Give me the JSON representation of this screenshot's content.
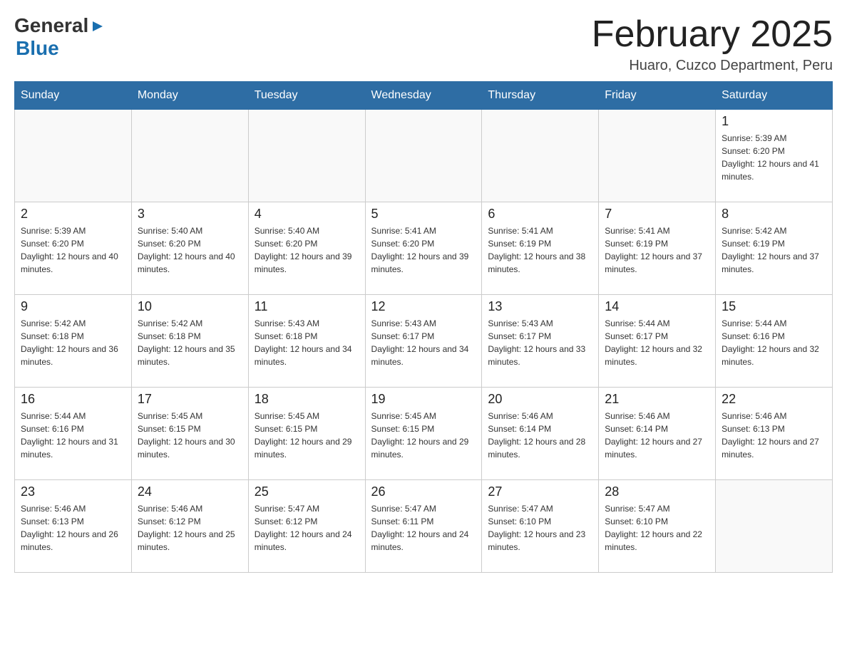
{
  "header": {
    "logo": {
      "general": "General",
      "arrow": "▶",
      "blue": "Blue"
    },
    "title": "February 2025",
    "subtitle": "Huaro, Cuzco Department, Peru"
  },
  "days_of_week": [
    "Sunday",
    "Monday",
    "Tuesday",
    "Wednesday",
    "Thursday",
    "Friday",
    "Saturday"
  ],
  "weeks": [
    [
      {
        "day": "",
        "sunrise": "",
        "sunset": "",
        "daylight": "",
        "empty": true
      },
      {
        "day": "",
        "sunrise": "",
        "sunset": "",
        "daylight": "",
        "empty": true
      },
      {
        "day": "",
        "sunrise": "",
        "sunset": "",
        "daylight": "",
        "empty": true
      },
      {
        "day": "",
        "sunrise": "",
        "sunset": "",
        "daylight": "",
        "empty": true
      },
      {
        "day": "",
        "sunrise": "",
        "sunset": "",
        "daylight": "",
        "empty": true
      },
      {
        "day": "",
        "sunrise": "",
        "sunset": "",
        "daylight": "",
        "empty": true
      },
      {
        "day": "1",
        "sunrise": "Sunrise: 5:39 AM",
        "sunset": "Sunset: 6:20 PM",
        "daylight": "Daylight: 12 hours and 41 minutes.",
        "empty": false
      }
    ],
    [
      {
        "day": "2",
        "sunrise": "Sunrise: 5:39 AM",
        "sunset": "Sunset: 6:20 PM",
        "daylight": "Daylight: 12 hours and 40 minutes.",
        "empty": false
      },
      {
        "day": "3",
        "sunrise": "Sunrise: 5:40 AM",
        "sunset": "Sunset: 6:20 PM",
        "daylight": "Daylight: 12 hours and 40 minutes.",
        "empty": false
      },
      {
        "day": "4",
        "sunrise": "Sunrise: 5:40 AM",
        "sunset": "Sunset: 6:20 PM",
        "daylight": "Daylight: 12 hours and 39 minutes.",
        "empty": false
      },
      {
        "day": "5",
        "sunrise": "Sunrise: 5:41 AM",
        "sunset": "Sunset: 6:20 PM",
        "daylight": "Daylight: 12 hours and 39 minutes.",
        "empty": false
      },
      {
        "day": "6",
        "sunrise": "Sunrise: 5:41 AM",
        "sunset": "Sunset: 6:19 PM",
        "daylight": "Daylight: 12 hours and 38 minutes.",
        "empty": false
      },
      {
        "day": "7",
        "sunrise": "Sunrise: 5:41 AM",
        "sunset": "Sunset: 6:19 PM",
        "daylight": "Daylight: 12 hours and 37 minutes.",
        "empty": false
      },
      {
        "day": "8",
        "sunrise": "Sunrise: 5:42 AM",
        "sunset": "Sunset: 6:19 PM",
        "daylight": "Daylight: 12 hours and 37 minutes.",
        "empty": false
      }
    ],
    [
      {
        "day": "9",
        "sunrise": "Sunrise: 5:42 AM",
        "sunset": "Sunset: 6:18 PM",
        "daylight": "Daylight: 12 hours and 36 minutes.",
        "empty": false
      },
      {
        "day": "10",
        "sunrise": "Sunrise: 5:42 AM",
        "sunset": "Sunset: 6:18 PM",
        "daylight": "Daylight: 12 hours and 35 minutes.",
        "empty": false
      },
      {
        "day": "11",
        "sunrise": "Sunrise: 5:43 AM",
        "sunset": "Sunset: 6:18 PM",
        "daylight": "Daylight: 12 hours and 34 minutes.",
        "empty": false
      },
      {
        "day": "12",
        "sunrise": "Sunrise: 5:43 AM",
        "sunset": "Sunset: 6:17 PM",
        "daylight": "Daylight: 12 hours and 34 minutes.",
        "empty": false
      },
      {
        "day": "13",
        "sunrise": "Sunrise: 5:43 AM",
        "sunset": "Sunset: 6:17 PM",
        "daylight": "Daylight: 12 hours and 33 minutes.",
        "empty": false
      },
      {
        "day": "14",
        "sunrise": "Sunrise: 5:44 AM",
        "sunset": "Sunset: 6:17 PM",
        "daylight": "Daylight: 12 hours and 32 minutes.",
        "empty": false
      },
      {
        "day": "15",
        "sunrise": "Sunrise: 5:44 AM",
        "sunset": "Sunset: 6:16 PM",
        "daylight": "Daylight: 12 hours and 32 minutes.",
        "empty": false
      }
    ],
    [
      {
        "day": "16",
        "sunrise": "Sunrise: 5:44 AM",
        "sunset": "Sunset: 6:16 PM",
        "daylight": "Daylight: 12 hours and 31 minutes.",
        "empty": false
      },
      {
        "day": "17",
        "sunrise": "Sunrise: 5:45 AM",
        "sunset": "Sunset: 6:15 PM",
        "daylight": "Daylight: 12 hours and 30 minutes.",
        "empty": false
      },
      {
        "day": "18",
        "sunrise": "Sunrise: 5:45 AM",
        "sunset": "Sunset: 6:15 PM",
        "daylight": "Daylight: 12 hours and 29 minutes.",
        "empty": false
      },
      {
        "day": "19",
        "sunrise": "Sunrise: 5:45 AM",
        "sunset": "Sunset: 6:15 PM",
        "daylight": "Daylight: 12 hours and 29 minutes.",
        "empty": false
      },
      {
        "day": "20",
        "sunrise": "Sunrise: 5:46 AM",
        "sunset": "Sunset: 6:14 PM",
        "daylight": "Daylight: 12 hours and 28 minutes.",
        "empty": false
      },
      {
        "day": "21",
        "sunrise": "Sunrise: 5:46 AM",
        "sunset": "Sunset: 6:14 PM",
        "daylight": "Daylight: 12 hours and 27 minutes.",
        "empty": false
      },
      {
        "day": "22",
        "sunrise": "Sunrise: 5:46 AM",
        "sunset": "Sunset: 6:13 PM",
        "daylight": "Daylight: 12 hours and 27 minutes.",
        "empty": false
      }
    ],
    [
      {
        "day": "23",
        "sunrise": "Sunrise: 5:46 AM",
        "sunset": "Sunset: 6:13 PM",
        "daylight": "Daylight: 12 hours and 26 minutes.",
        "empty": false
      },
      {
        "day": "24",
        "sunrise": "Sunrise: 5:46 AM",
        "sunset": "Sunset: 6:12 PM",
        "daylight": "Daylight: 12 hours and 25 minutes.",
        "empty": false
      },
      {
        "day": "25",
        "sunrise": "Sunrise: 5:47 AM",
        "sunset": "Sunset: 6:12 PM",
        "daylight": "Daylight: 12 hours and 24 minutes.",
        "empty": false
      },
      {
        "day": "26",
        "sunrise": "Sunrise: 5:47 AM",
        "sunset": "Sunset: 6:11 PM",
        "daylight": "Daylight: 12 hours and 24 minutes.",
        "empty": false
      },
      {
        "day": "27",
        "sunrise": "Sunrise: 5:47 AM",
        "sunset": "Sunset: 6:10 PM",
        "daylight": "Daylight: 12 hours and 23 minutes.",
        "empty": false
      },
      {
        "day": "28",
        "sunrise": "Sunrise: 5:47 AM",
        "sunset": "Sunset: 6:10 PM",
        "daylight": "Daylight: 12 hours and 22 minutes.",
        "empty": false
      },
      {
        "day": "",
        "sunrise": "",
        "sunset": "",
        "daylight": "",
        "empty": true
      }
    ]
  ]
}
